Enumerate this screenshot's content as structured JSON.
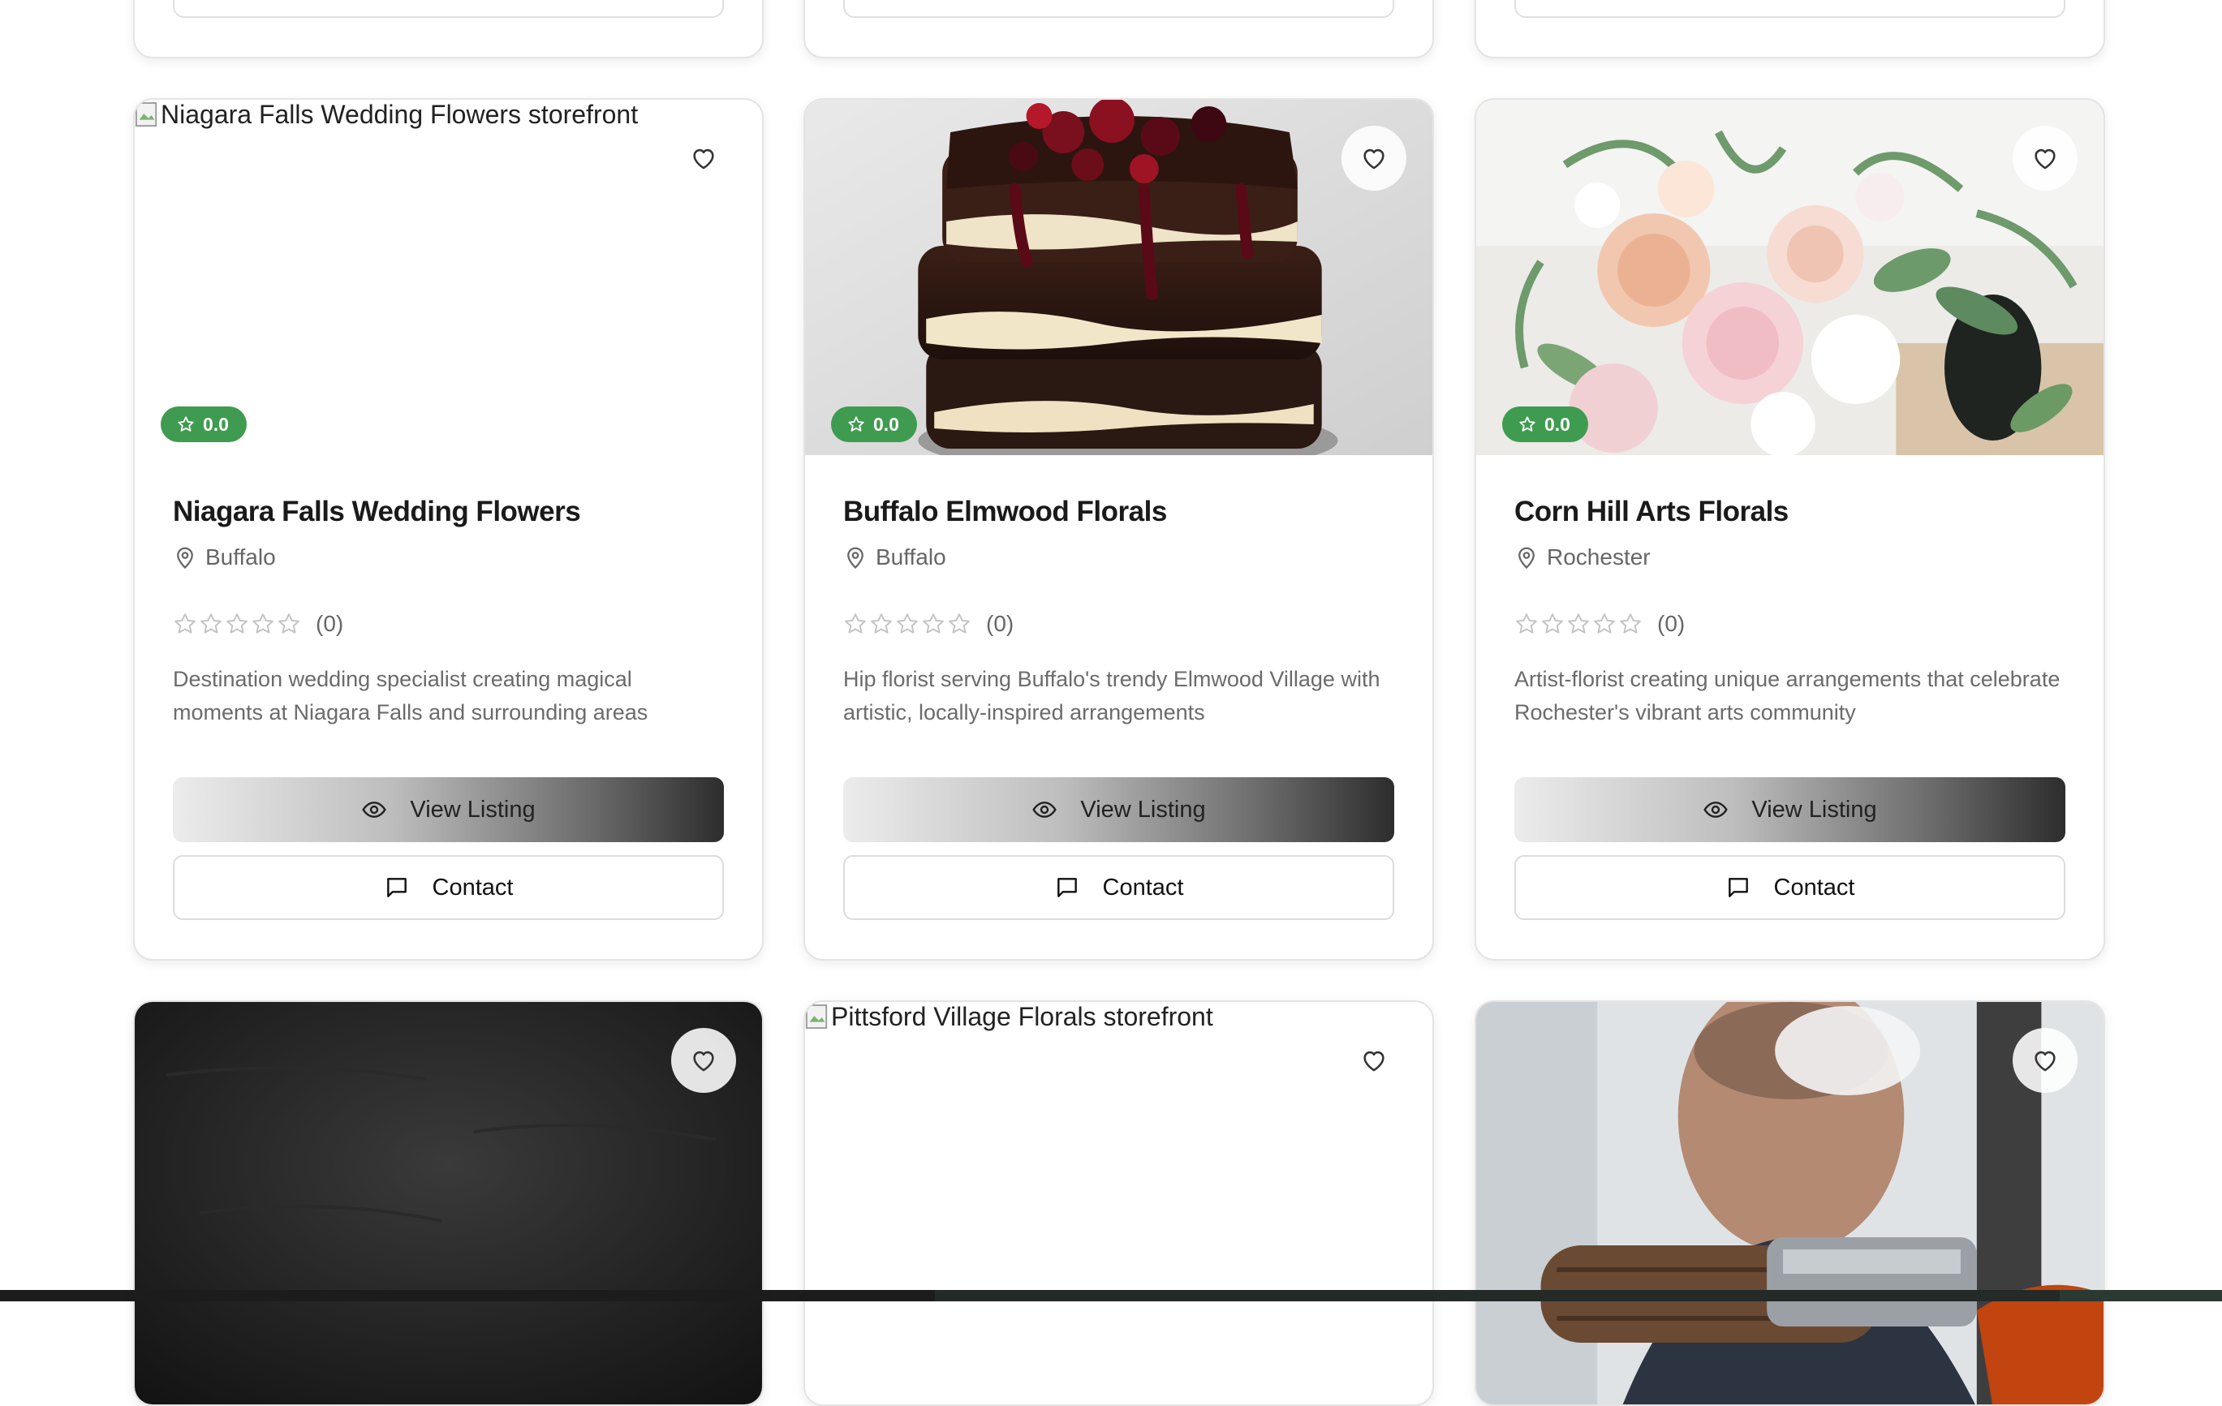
{
  "cards": [
    {
      "name": "Niagara Falls Wedding Flowers",
      "location": "Buffalo",
      "rating_badge": "0.0",
      "review_count": "(0)",
      "description": "Destination wedding specialist creating magical moments at Niagara Falls and surrounding areas",
      "image_alt": "Niagara Falls Wedding Flowers storefront",
      "view_label": "View Listing",
      "contact_label": "Contact"
    },
    {
      "name": "Buffalo Elmwood Florals",
      "location": "Buffalo",
      "rating_badge": "0.0",
      "review_count": "(0)",
      "description": "Hip florist serving Buffalo's trendy Elmwood Village with artistic, locally-inspired arrangements",
      "view_label": "View Listing",
      "contact_label": "Contact"
    },
    {
      "name": "Corn Hill Arts Florals",
      "location": "Rochester",
      "rating_badge": "0.0",
      "review_count": "(0)",
      "description": "Artist-florist creating unique arrangements that celebrate Rochester's vibrant arts community",
      "view_label": "View Listing",
      "contact_label": "Contact"
    }
  ],
  "bottom_row": [
    {
      "image": "dark-texture"
    },
    {
      "image_alt": "Pittsford Village Florals storefront"
    },
    {
      "image": "craftsman-photo"
    }
  ],
  "colors": {
    "badge_green": "#3f9b4f",
    "card_border": "#e4e4e4"
  },
  "icons": [
    "heart-icon",
    "star-icon",
    "map-pin-icon",
    "eye-icon",
    "message-square-icon"
  ]
}
